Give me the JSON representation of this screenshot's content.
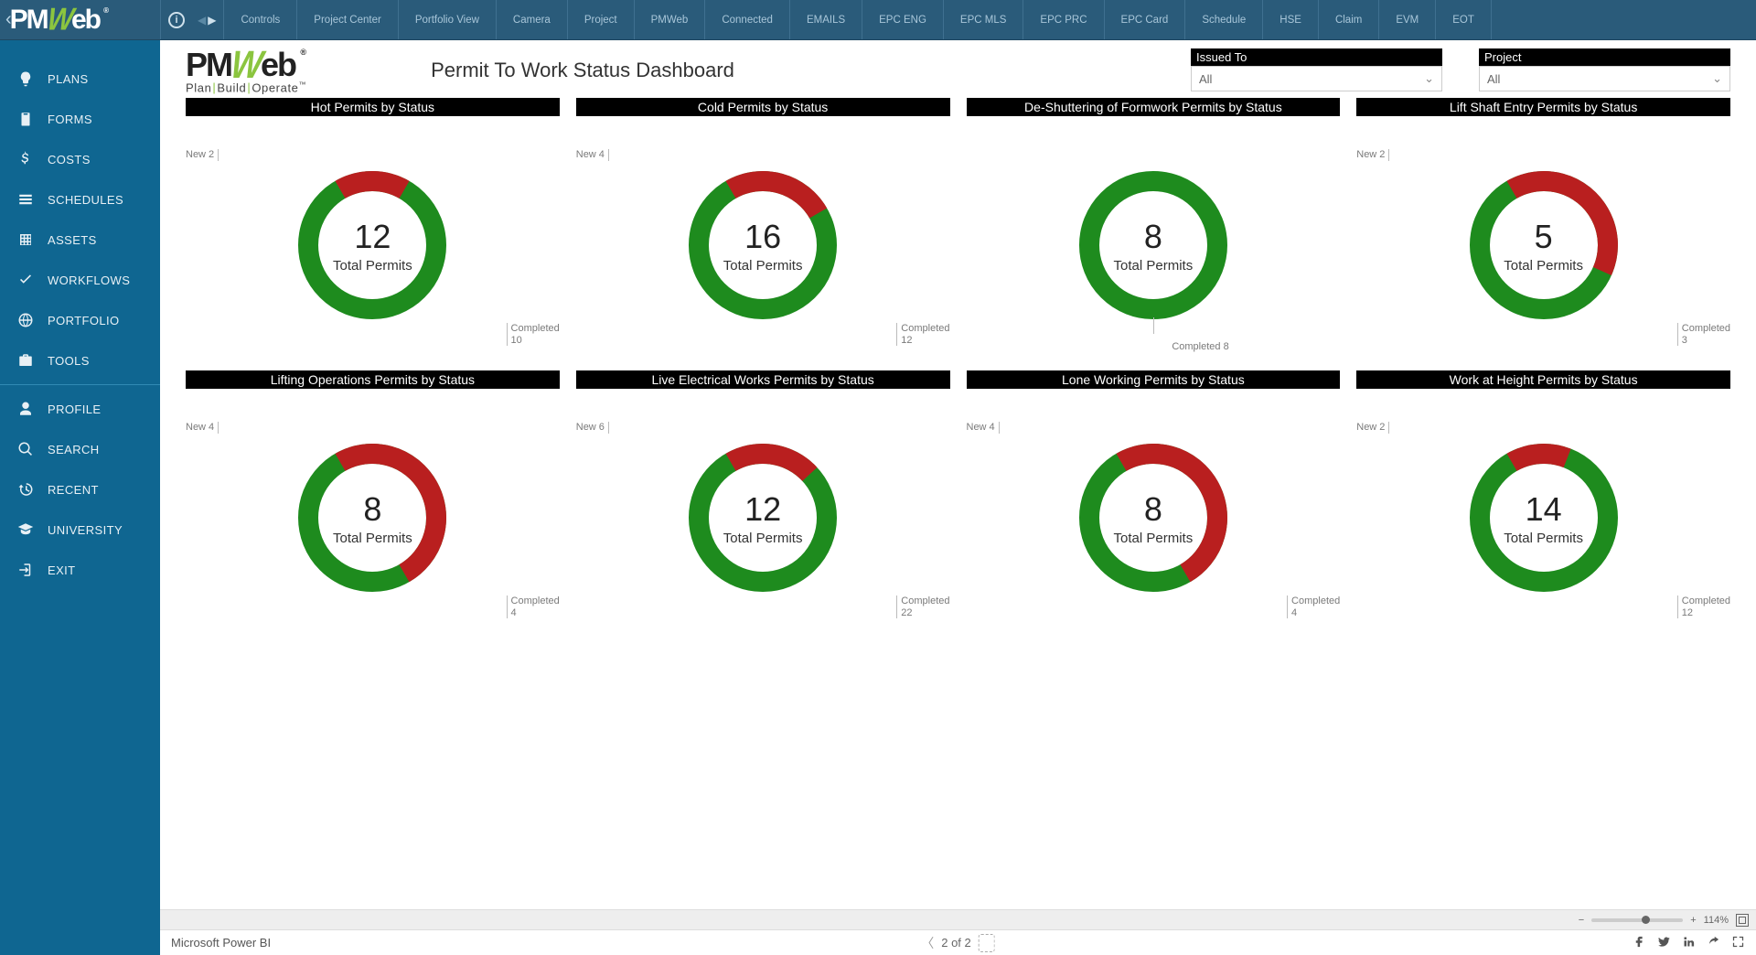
{
  "brand": {
    "caret": "‹",
    "name": "PMWeb",
    "tagline_plan": "Plan",
    "tagline_build": "Build",
    "tagline_operate": "Operate",
    "regmark": "®",
    "tm": "™"
  },
  "top_tabs": [
    "Controls",
    "Project Center",
    "Portfolio View",
    "Camera",
    "Project",
    "PMWeb",
    "Connected",
    "EMAILS",
    "EPC ENG",
    "EPC MLS",
    "EPC PRC",
    "EPC Card",
    "Schedule",
    "HSE",
    "Claim",
    "EVM",
    "EOT"
  ],
  "sidebar": [
    {
      "icon": "bulb",
      "label": "PLANS"
    },
    {
      "icon": "clipboard",
      "label": "FORMS"
    },
    {
      "icon": "dollar",
      "label": "COSTS"
    },
    {
      "icon": "bars",
      "label": "SCHEDULES"
    },
    {
      "icon": "grid",
      "label": "ASSETS"
    },
    {
      "icon": "check",
      "label": "WORKFLOWS"
    },
    {
      "icon": "globe",
      "label": "PORTFOLIO"
    },
    {
      "icon": "briefcase",
      "label": "TOOLS"
    }
  ],
  "sidebar2": [
    {
      "icon": "user",
      "label": "PROFILE"
    },
    {
      "icon": "search",
      "label": "SEARCH"
    },
    {
      "icon": "recent",
      "label": "RECENT"
    },
    {
      "icon": "grad",
      "label": "UNIVERSITY"
    },
    {
      "icon": "exit",
      "label": "EXIT"
    }
  ],
  "dashboard_title": "Permit To Work Status Dashboard",
  "filters": {
    "issued_to": {
      "label": "Issued To",
      "value": "All"
    },
    "project": {
      "label": "Project",
      "value": "All"
    }
  },
  "chart_titles_row1": [
    "Hot Permits by Status",
    "Cold Permits by Status",
    "De-Shuttering of Formwork Permits by Status",
    "Lift Shaft Entry Permits by Status"
  ],
  "chart_titles_row2": [
    "Lifting Operations Permits by Status",
    "Live Electrical Works Permits by Status",
    "Lone Working Permits by Status",
    "Work at Height Permits by Status"
  ],
  "center_label": "Total Permits",
  "colors": {
    "new": "#b91f1f",
    "completed": "#1e8b1e"
  },
  "chart_data": [
    {
      "type": "pie",
      "title": "Hot Permits by Status",
      "total": 12,
      "series": [
        {
          "name": "New",
          "value": 2
        },
        {
          "name": "Completed",
          "value": 10
        }
      ]
    },
    {
      "type": "pie",
      "title": "Cold Permits by Status",
      "total": 16,
      "series": [
        {
          "name": "New",
          "value": 4
        },
        {
          "name": "Completed",
          "value": 12
        }
      ]
    },
    {
      "type": "pie",
      "title": "De-Shuttering of Formwork Permits by Status",
      "total": 8,
      "series": [
        {
          "name": "Completed",
          "value": 8
        }
      ]
    },
    {
      "type": "pie",
      "title": "Lift Shaft Entry Permits by Status",
      "total": 5,
      "series": [
        {
          "name": "New",
          "value": 2
        },
        {
          "name": "Completed",
          "value": 3
        }
      ]
    },
    {
      "type": "pie",
      "title": "Lifting Operations Permits by Status",
      "total": 8,
      "series": [
        {
          "name": "New",
          "value": 4
        },
        {
          "name": "Completed",
          "value": 4
        }
      ]
    },
    {
      "type": "pie",
      "title": "Live Electrical Works Permits by Status",
      "total": 12,
      "series": [
        {
          "name": "New",
          "value": 6
        },
        {
          "name": "Completed",
          "value": 22
        }
      ]
    },
    {
      "type": "pie",
      "title": "Lone Working Permits by Status",
      "total": 8,
      "series": [
        {
          "name": "New",
          "value": 4
        },
        {
          "name": "Completed",
          "value": 4
        }
      ]
    },
    {
      "type": "pie",
      "title": "Work at Height Permits by Status",
      "total": 14,
      "series": [
        {
          "name": "New",
          "value": 2
        },
        {
          "name": "Completed",
          "value": 12
        }
      ]
    }
  ],
  "zoom": "114%",
  "pager": {
    "text": "2 of 2"
  },
  "footer_brand": "Microsoft Power BI"
}
